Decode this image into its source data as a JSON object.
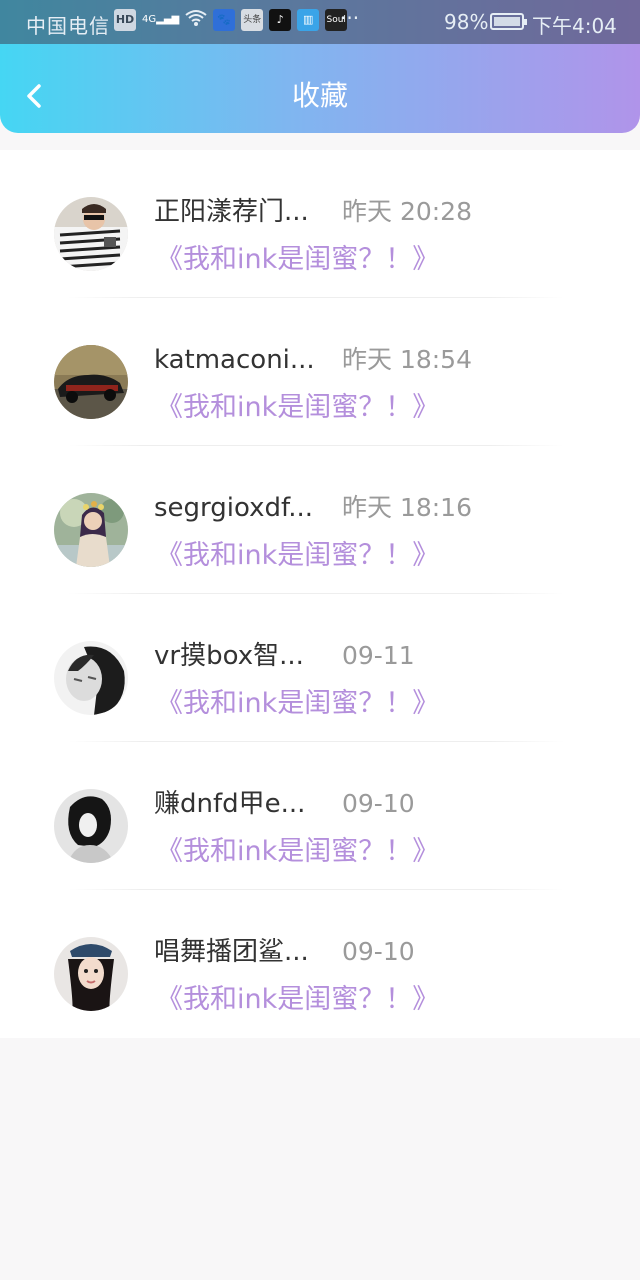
{
  "status_bar": {
    "carrier": "中国电信",
    "hd": "HD",
    "network": "4G",
    "app_icons": [
      "baidu-icon",
      "toutiao-icon",
      "tiktok-icon",
      "reader-icon",
      "soul-icon"
    ],
    "more": "···",
    "battery": "98%",
    "time": "下午4:04"
  },
  "header": {
    "title": "收藏"
  },
  "items": [
    {
      "name": "正阳漾荐门...",
      "time": "昨天 20:28",
      "title": "《我和ink是闺蜜？！》"
    },
    {
      "name": "katmaconi...",
      "time": "昨天 18:54",
      "title": "《我和ink是闺蜜？！》"
    },
    {
      "name": "segrgioxdf...",
      "time": "昨天 18:16",
      "title": "《我和ink是闺蜜？！》"
    },
    {
      "name": "vr摸box智...",
      "time": "09-11",
      "title": "《我和ink是闺蜜？！》"
    },
    {
      "name": "赚dnfd甲e...",
      "time": "09-10",
      "title": "《我和ink是闺蜜？！》"
    },
    {
      "name": "唱舞播团鲨...",
      "time": "09-10",
      "title": "《我和ink是闺蜜？！》"
    }
  ],
  "colors": {
    "accent_title": "#b48fdc",
    "header_gradient_start": "#45d6f3",
    "header_gradient_end": "#b094ea"
  }
}
